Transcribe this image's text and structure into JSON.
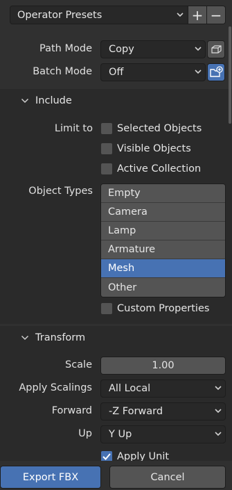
{
  "presets": {
    "label": "Operator Presets",
    "add_symbol": "+",
    "remove_symbol": "−"
  },
  "path_mode": {
    "label": "Path Mode",
    "value": "Copy"
  },
  "batch_mode": {
    "label": "Batch Mode",
    "value": "Off"
  },
  "include": {
    "title": "Include",
    "limit_to_label": "Limit to",
    "limit_to": [
      {
        "label": "Selected Objects",
        "checked": false
      },
      {
        "label": "Visible Objects",
        "checked": false
      },
      {
        "label": "Active Collection",
        "checked": false
      }
    ],
    "object_types_label": "Object Types",
    "object_types": [
      {
        "label": "Empty",
        "selected": false
      },
      {
        "label": "Camera",
        "selected": false
      },
      {
        "label": "Lamp",
        "selected": false
      },
      {
        "label": "Armature",
        "selected": false
      },
      {
        "label": "Mesh",
        "selected": true
      },
      {
        "label": "Other",
        "selected": false
      }
    ],
    "custom_properties": {
      "label": "Custom Properties",
      "checked": false
    }
  },
  "transform": {
    "title": "Transform",
    "scale": {
      "label": "Scale",
      "value": "1.00"
    },
    "apply_scalings": {
      "label": "Apply Scalings",
      "value": "All Local"
    },
    "forward": {
      "label": "Forward",
      "value": "-Z Forward"
    },
    "up": {
      "label": "Up",
      "value": "Y Up"
    },
    "apply_unit": {
      "label": "Apply Unit",
      "checked": true
    }
  },
  "footer": {
    "export_label": "Export FBX",
    "cancel_label": "Cancel"
  },
  "colors": {
    "accent": "#4772b3",
    "panel": "#303030",
    "section": "#2a2a2a",
    "widget": "#545454",
    "field": "#282828"
  }
}
